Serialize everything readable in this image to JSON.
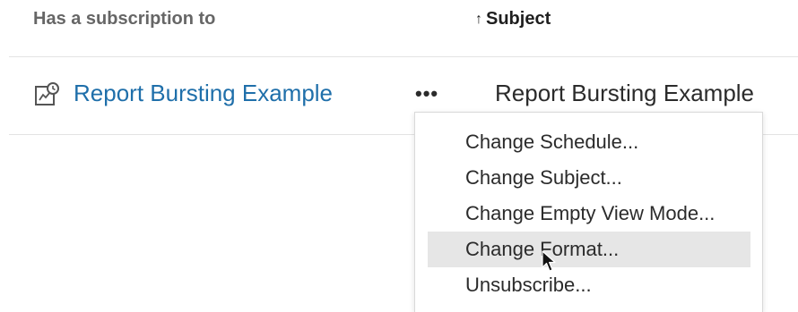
{
  "table": {
    "headers": {
      "subscription": "Has a subscription to",
      "subject_sort_arrow": "↑",
      "subject": "Subject"
    },
    "row": {
      "icon": "subscription-view-icon",
      "link": "Report Bursting Example",
      "more": "•••",
      "subject": "Report Bursting Example"
    }
  },
  "menu": {
    "items": [
      {
        "label": "Change Schedule..."
      },
      {
        "label": "Change Subject..."
      },
      {
        "label": "Change Empty View Mode..."
      },
      {
        "label": "Change Format..."
      },
      {
        "label": "Unsubscribe..."
      }
    ],
    "highlighted_index": 3
  },
  "colors": {
    "link": "#1f6faa",
    "menu_highlight": "#e6e6e6"
  }
}
